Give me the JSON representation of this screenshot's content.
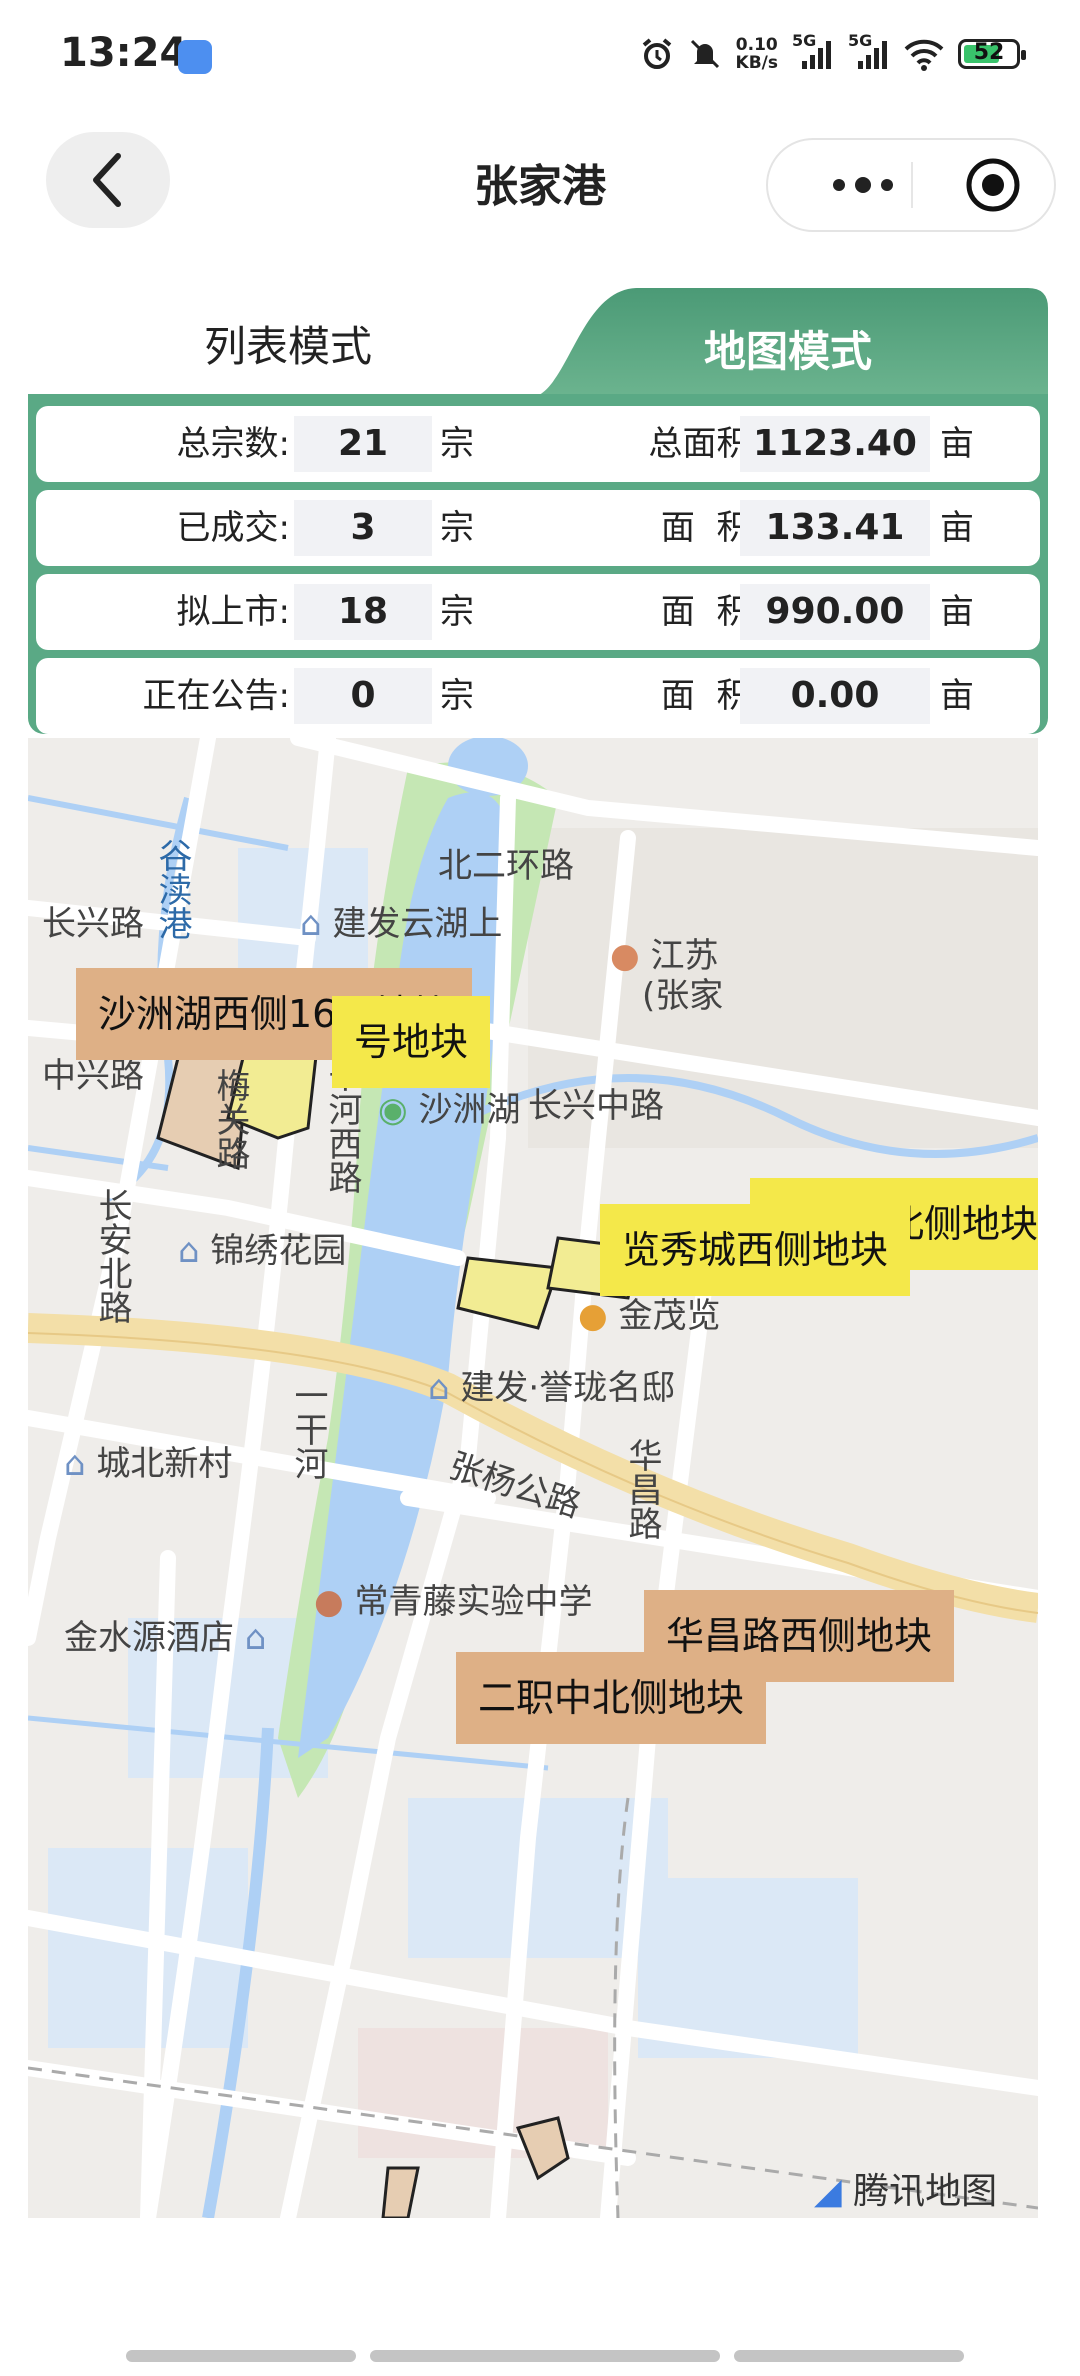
{
  "status_bar": {
    "time": "13:24",
    "net_speed_top": "0.10",
    "net_speed_bottom": "KB/s",
    "sim1": "5G",
    "sim2": "5G",
    "battery": "52",
    "icons": [
      "app-icon",
      "alarm-icon",
      "mute-icon",
      "signal-icon",
      "signal-icon",
      "wifi-icon",
      "battery-icon"
    ]
  },
  "header": {
    "title": "张家港",
    "back_icon": "chevron-left-icon",
    "more_icon": "more-dots-icon",
    "close_icon": "target-icon"
  },
  "tabs": [
    {
      "label": "列表模式",
      "active": false
    },
    {
      "label": "地图模式",
      "active": true
    }
  ],
  "colors": {
    "accent": "#5aa985",
    "orange_parcel": "#deb086",
    "yellow_parcel": "#f4e84a",
    "water": "#aed0f5",
    "park": "#c5e7b4"
  },
  "stats": [
    {
      "label": "总宗数:",
      "count": "21",
      "count_unit": "宗",
      "area_label": "总面积:",
      "area": "1123.40",
      "area_unit": "亩"
    },
    {
      "label": "已成交:",
      "count": "3",
      "count_unit": "宗",
      "area_label": "面  积:",
      "area": "133.41",
      "area_unit": "亩"
    },
    {
      "label": "拟上市:",
      "count": "18",
      "count_unit": "宗",
      "area_label": "面  积:",
      "area": "990.00",
      "area_unit": "亩"
    },
    {
      "label": "正在公告:",
      "count": "0",
      "count_unit": "宗",
      "area_label": "面  积:",
      "area": "0.00",
      "area_unit": "亩"
    }
  ],
  "map": {
    "roads": [
      "北二环路",
      "长兴路",
      "中兴路",
      "长兴中路",
      "长安北路",
      "一干河",
      "张杨公路",
      "华昌路",
      "谷渎港",
      "干河西路",
      "梅关路"
    ],
    "pois": [
      "建发云湖上",
      "沙洲湖",
      "江苏",
      "(张家",
      "锦绣花园",
      "金茂览",
      "建发·誉珑名邸",
      "城北新村",
      "常青藤实验中学",
      "金水源酒店"
    ],
    "parcels": [
      {
        "name": "沙洲湖西侧16号地块",
        "color": "orange"
      },
      {
        "name": "号地块",
        "color": "yellow"
      },
      {
        "name": "览秀城北侧地块",
        "color": "yellow"
      },
      {
        "name": "览秀城西侧地块",
        "color": "yellow"
      },
      {
        "name": "华昌路西侧地块",
        "color": "orange"
      },
      {
        "name": "二职中北侧地块",
        "color": "orange"
      }
    ],
    "watermark": "腾讯地图"
  }
}
